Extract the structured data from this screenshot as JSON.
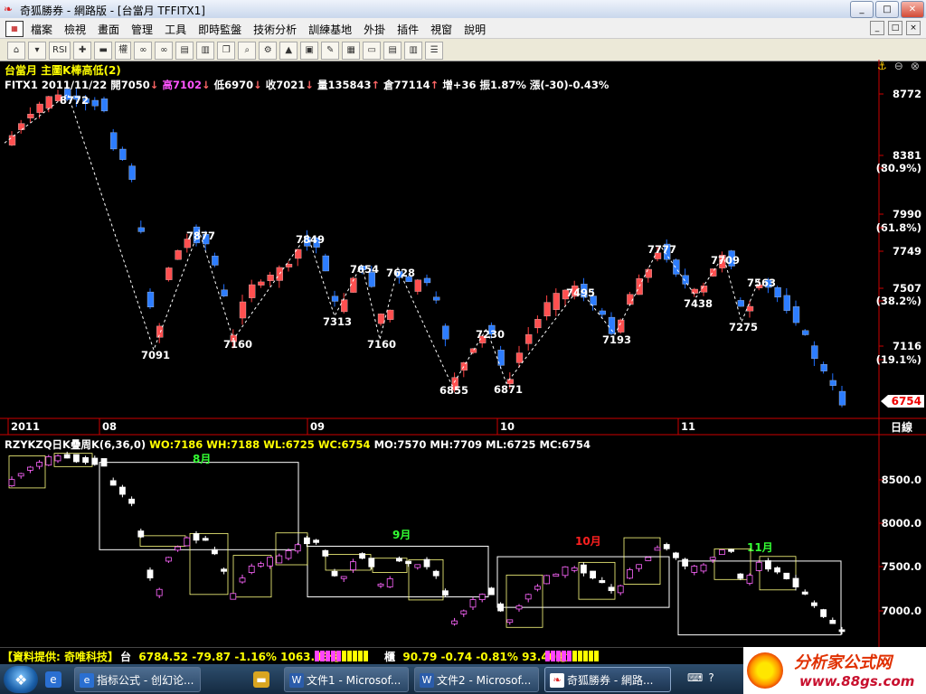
{
  "window": {
    "title": "奇狐勝券 - 網路版 - [台當月 TFFITX1]",
    "controls": {
      "minimize": "_",
      "maximize": "□",
      "close": "✕"
    }
  },
  "menu": {
    "items": [
      "檔案",
      "檢視",
      "畫面",
      "管理",
      "工具",
      "即時監盤",
      "技術分析",
      "訓練基地",
      "外掛",
      "插件",
      "視窗",
      "說明"
    ],
    "right": [
      "_",
      "□",
      "×"
    ]
  },
  "toolbar": {
    "icons": [
      "home-icon",
      "dropdown-icon",
      "rsi-icon",
      "add-icon",
      "remove-icon",
      "chart-type-icon",
      "glasses-icon",
      "glasses2-icon",
      "calc-icon",
      "book-icon",
      "copy-icon",
      "find-icon",
      "gear-icon",
      "alert-icon",
      "lock-icon",
      "pen-icon",
      "table-icon",
      "window-icon",
      "tile-icon",
      "layout-icon",
      "list-icon"
    ],
    "text_labels": {
      "rsi": "RSI",
      "chart_type": "權"
    }
  },
  "main_chart": {
    "title": "台當月 主圖K棒高低(2)",
    "quote_line": {
      "symbol_date": "FITX1 2011/11/22",
      "open": "開7050",
      "high": "高7102",
      "low": "低6970",
      "close": "收7021",
      "volume": "量135843",
      "oi": "倉77114",
      "oi_change": "增+36",
      "amplitude": "振1.87%",
      "change": "漲(-30)-0.43%"
    },
    "axis_labels": [
      "8772",
      "8381",
      "(80.9%)",
      "7990",
      "(61.8%)",
      "7749",
      "7507",
      "(38.2%)",
      "7116",
      "(19.1%)"
    ],
    "last_price": "6754",
    "period_label": "日線",
    "time_labels": [
      "2011",
      "08",
      "09",
      "10",
      "11"
    ],
    "pivot_labels": [
      "8772",
      "7091",
      "7877",
      "7160",
      "7849",
      "7313",
      "7654",
      "7160",
      "7628",
      "6855",
      "7230",
      "6871",
      "7495",
      "7193",
      "7777",
      "7438",
      "7709",
      "7275",
      "7563"
    ],
    "colors": {
      "up": "#ff4040",
      "down": "#1f6fff",
      "zigzag": "#ffffff",
      "axis": "#ff0000"
    }
  },
  "sub_chart": {
    "indicator_name": "RZYKZQ日K疊周K(6,36,0)",
    "values": {
      "WO": "WO:7186",
      "WH": "WH:7188",
      "WL": "WL:6725",
      "WC": "WC:6754",
      "MO": "MO:7570",
      "MH": "MH:7709",
      "ML": "ML:6725",
      "MC": "MC:6754"
    },
    "axis_labels": [
      "8500.0",
      "8000.0",
      "7500.0",
      "7000.0"
    ],
    "month_labels": [
      {
        "text": "8月",
        "color": "#33ff33"
      },
      {
        "text": "9月",
        "color": "#33ff33"
      },
      {
        "text": "10月",
        "color": "#ff2020"
      },
      {
        "text": "11月",
        "color": "#33ff33"
      }
    ]
  },
  "status_bar": {
    "provider": "【資料提供: 奇唯科技】",
    "index1_name": "台",
    "index1": "6784.52 -79.87 -1.16% 1063.43億",
    "index2_name": "櫃",
    "index2": "90.79 -0.74 -0.81% 93.40億"
  },
  "taskbar": {
    "tasks": [
      {
        "label": "指标公式 - 创幻论...",
        "icon": "ie-icon"
      },
      {
        "label": "文件1 - Microsof...",
        "icon": "word-icon"
      },
      {
        "label": "文件2 - Microsof...",
        "icon": "word-icon"
      },
      {
        "label": "奇狐勝券 - 網路...",
        "icon": "app-icon"
      }
    ]
  },
  "watermark": {
    "title": "分析家公式网",
    "url": "www.88gs.com"
  }
}
